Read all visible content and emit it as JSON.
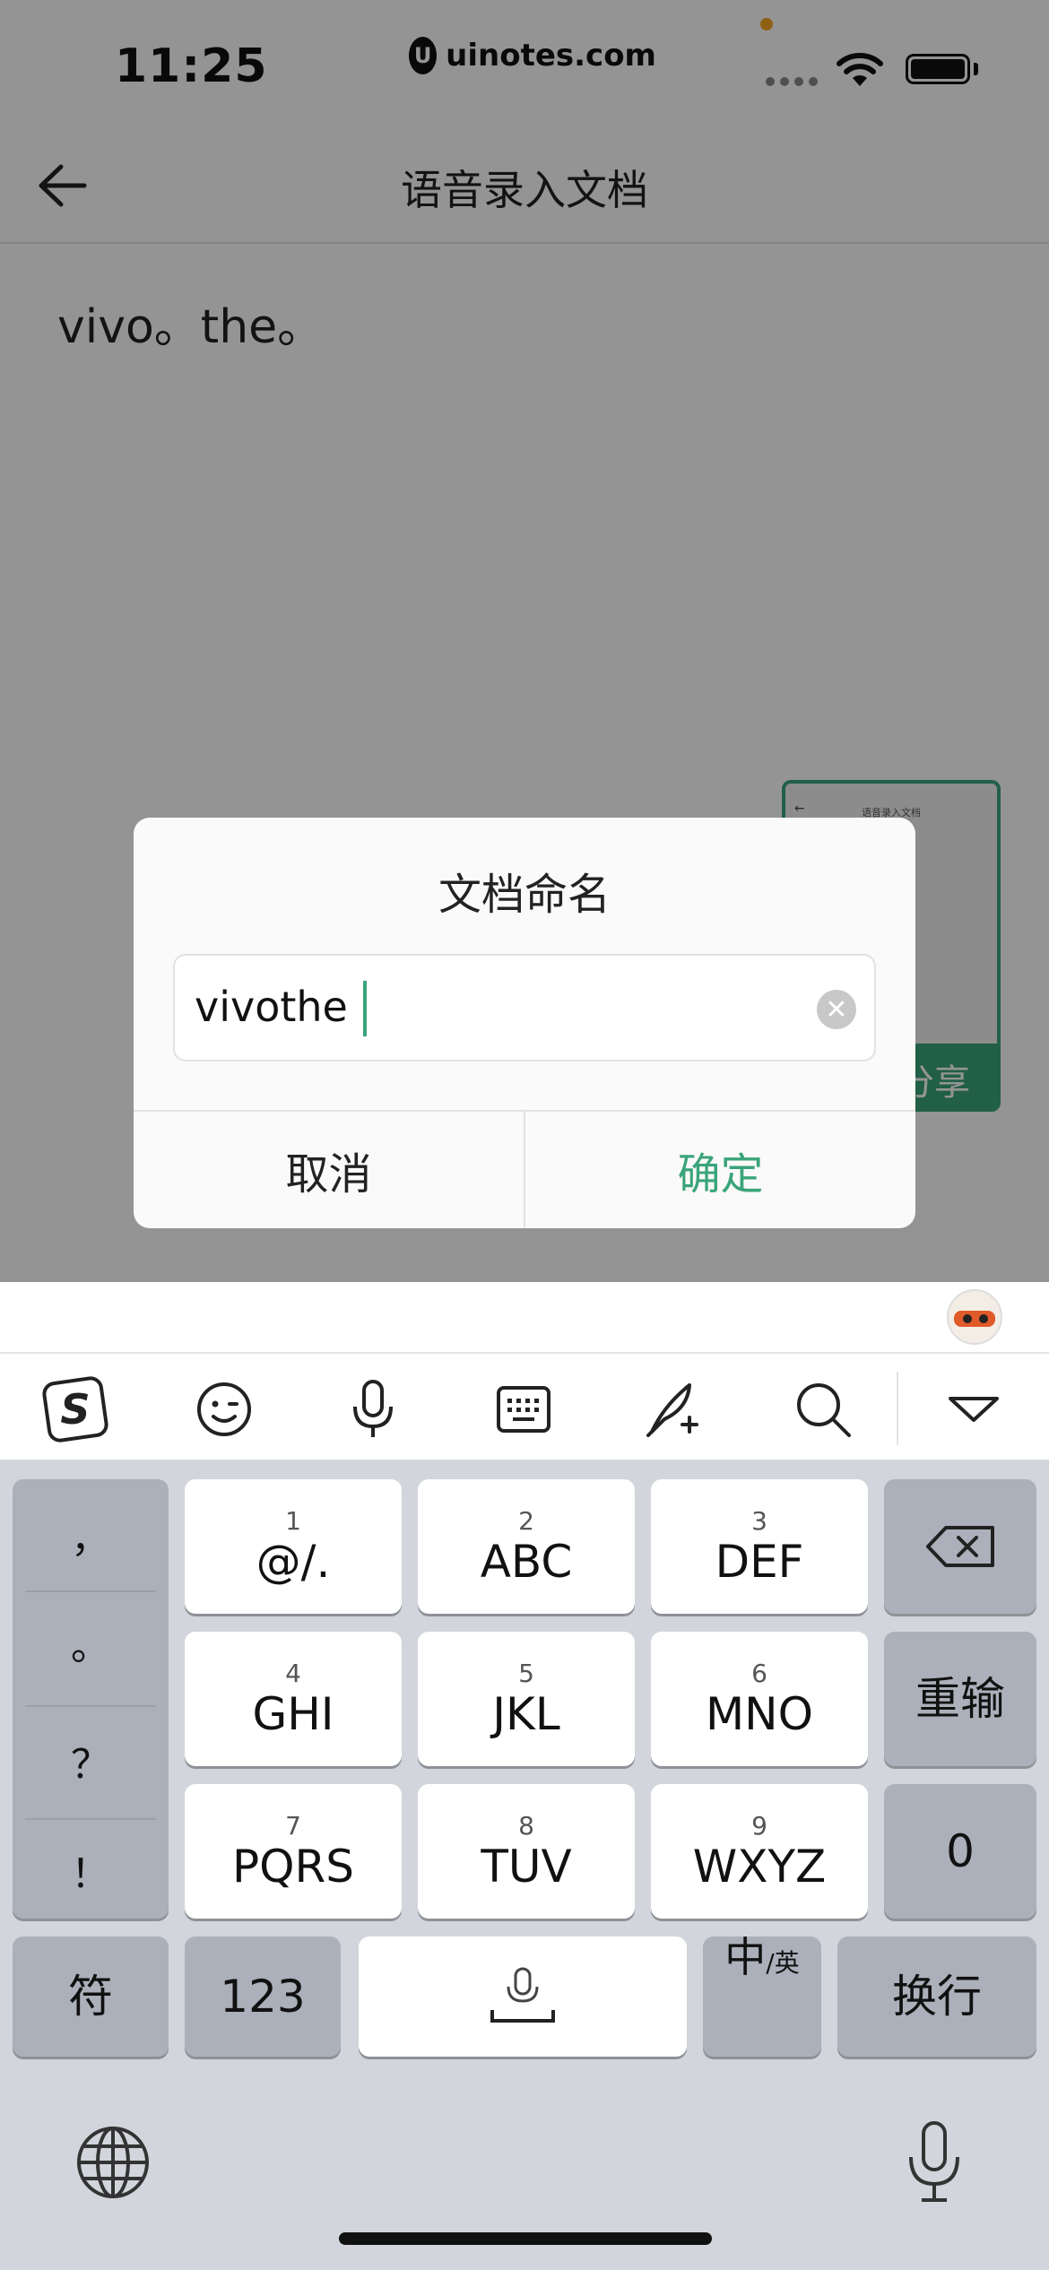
{
  "status_bar": {
    "time": "11:25",
    "url": "uinotes.com",
    "logo_letter": "U"
  },
  "nav": {
    "title": "语音录入文档",
    "back_icon": "back-arrow-icon"
  },
  "document": {
    "text": "vivo。the。"
  },
  "preview_thumbnail": {
    "title": "语音录入文档",
    "share_label": "分享"
  },
  "dialog": {
    "title": "文档命名",
    "input_value": "vivothe",
    "cancel_label": "取消",
    "confirm_label": "确定",
    "accent_color": "#3aa47b"
  },
  "keyboard": {
    "toolbar_icons": [
      "sogou-logo-icon",
      "emoji-icon",
      "microphone-icon",
      "keyboard-icon",
      "handwriting-icon",
      "search-icon",
      "collapse-icon"
    ],
    "punctuation": [
      "，",
      "。",
      "？",
      "！"
    ],
    "keys": [
      {
        "num": "1",
        "label": "@/."
      },
      {
        "num": "2",
        "label": "ABC"
      },
      {
        "num": "3",
        "label": "DEF"
      },
      {
        "num": "4",
        "label": "GHI"
      },
      {
        "num": "5",
        "label": "JKL"
      },
      {
        "num": "6",
        "label": "MNO"
      },
      {
        "num": "7",
        "label": "PQRS"
      },
      {
        "num": "8",
        "label": "TUV"
      },
      {
        "num": "9",
        "label": "WXYZ"
      }
    ],
    "retype_label": "重输",
    "zero_label": "0",
    "symbol_label": "符",
    "numeric_label": "123",
    "lang_main": "中",
    "lang_sub": "/英",
    "enter_label": "换行"
  }
}
